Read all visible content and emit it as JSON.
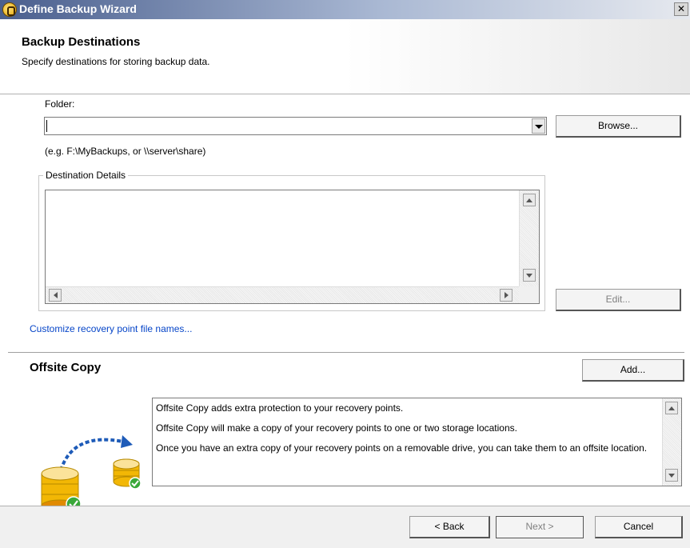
{
  "window": {
    "title": "Define Backup Wizard",
    "close_glyph": "✕"
  },
  "header": {
    "title": "Backup Destinations",
    "subtitle": "Specify destinations for storing backup data."
  },
  "folder": {
    "label": "Folder:",
    "value": "",
    "hint": "(e.g. F:\\MyBackups, or \\\\server\\share)",
    "browse_label": "Browse..."
  },
  "destination": {
    "group_label": "Destination Details",
    "edit_label": "Edit..."
  },
  "customize_link": "Customize recovery point file names...",
  "offsite": {
    "title": "Offsite Copy",
    "add_label": "Add...",
    "paragraphs": [
      "Offsite Copy adds extra protection to your recovery points.",
      "Offsite Copy will make a copy of your recovery points to one or two storage locations.",
      "Once you have an extra copy of your recovery points on a removable drive, you can take them to an offsite location."
    ]
  },
  "footer": {
    "back_label": "< Back",
    "next_label": "Next >",
    "cancel_label": "Cancel"
  },
  "colors": {
    "link": "#0645c8",
    "title_bar_start": "#4a5f8e",
    "disabled_text": "#808080",
    "disk_gold": "#f2b705",
    "check_green": "#3aa83a",
    "arrow_blue": "#1e5bb8"
  },
  "icons": [
    "app-icon",
    "close-icon",
    "dropdown-arrow-icon",
    "database-icon",
    "check-icon",
    "curved-arrow-icon"
  ]
}
